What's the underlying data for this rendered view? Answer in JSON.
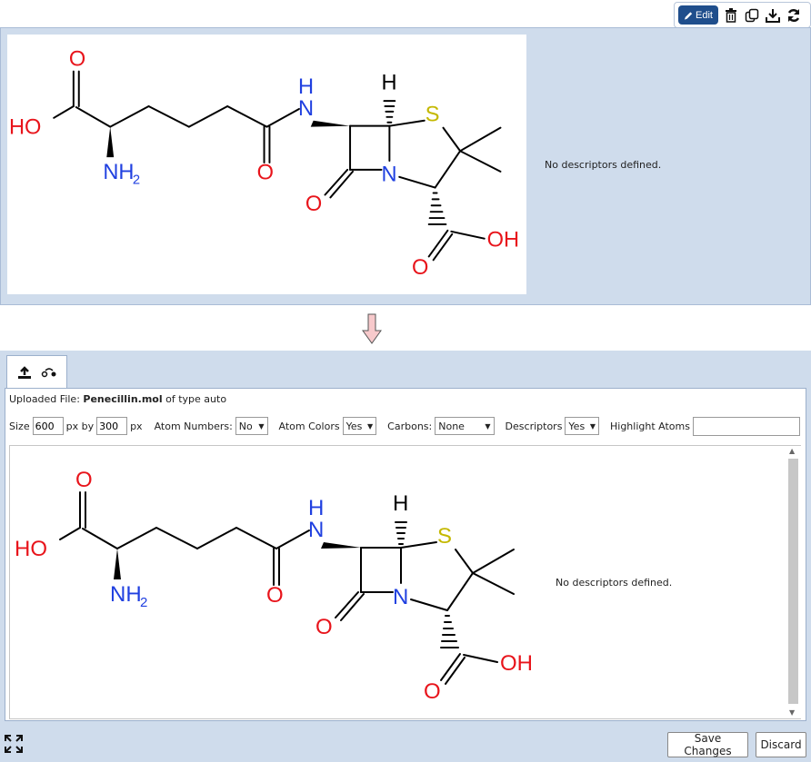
{
  "toolbar": {
    "edit_label": "Edit",
    "icons": [
      "pencil-icon",
      "trash-icon",
      "copy-icon",
      "download-icon",
      "refresh-icon"
    ]
  },
  "viewer": {
    "descriptors_text": "No descriptors defined."
  },
  "editor": {
    "uploaded_prefix": "Uploaded File:",
    "file_name": "Penecillin.mol",
    "type_text": "of type auto",
    "size_label": "Size",
    "width_value": "600",
    "px_by_label": "px by",
    "height_value": "300",
    "px_label": "px",
    "atom_numbers_label": "Atom Numbers:",
    "atom_numbers_value": "No",
    "atom_colors_label": "Atom Colors",
    "atom_colors_value": "Yes",
    "carbons_label": "Carbons:",
    "carbons_value": "None",
    "descriptors_label": "Descriptors",
    "descriptors_value": "Yes",
    "highlight_label": "Highlight Atoms",
    "highlight_value": "",
    "descriptors_text": "No descriptors defined.",
    "save_label": "Save Changes",
    "discard_label": "Discard"
  },
  "colors": {
    "panel_bg": "#cfdcec",
    "edit_button": "#1f4e8c",
    "oxygen": "#e8141b",
    "nitrogen": "#2040e0",
    "sulfur": "#c4b800",
    "arrow_fill": "#f7c9cb"
  }
}
